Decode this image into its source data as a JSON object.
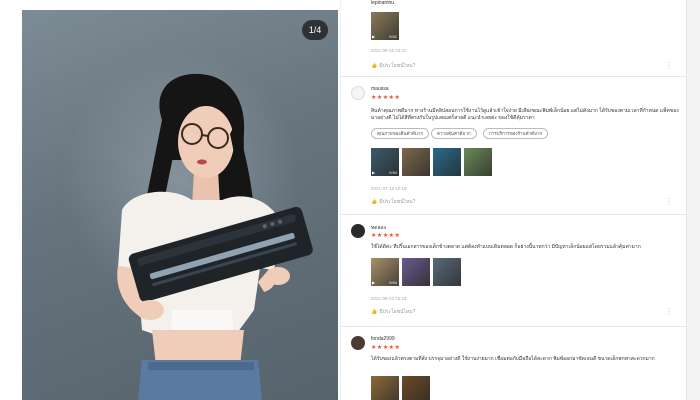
{
  "photo": {
    "counter": "1/4"
  },
  "reviews": [
    {
      "username": "lepinamnu",
      "thumbs": [
        {
          "color": "#8a7a5a",
          "duration": "0:51"
        }
      ],
      "date": "2021-08-16 23:37",
      "helpful": "มีประโยชน์ไหม?"
    },
    {
      "username": "maussa",
      "stars": "★★★★★",
      "text": "สินค้าคุณภาพดีมาก ทางร้านมีคลิปสอนการใช้งานไว้ดูแล้วเข้าใจง่าย มีเสียงขณะพิมพ์เล็กน้อย แต่ไม่ดังมาก ได้รับของตามเวลาที่กำหนด แพ็คของมาอย่างดี ไม่ได้สีที่ตรงกับในรูปเลยแต่ก็สวยดี แนะนำเลยค่ะ ของใช้ดีคุ้มราคา",
      "tags": [
        "คุณภาพของสินค้าดีมาก",
        "ความคุ้มค่าดีมาก",
        "การบริการของร้านค้าดีมาก"
      ],
      "thumbs": [
        {
          "color": "#3c5a6a",
          "duration": "0:54"
        },
        {
          "color": "#7b6a4c"
        },
        {
          "color": "#2a6a8a"
        },
        {
          "color": "#6a8a5a"
        }
      ],
      "date": "2021-07-12 10:18",
      "helpful": "มีประโยชน์ไหม?"
    },
    {
      "username": "ทดลอง",
      "stars": "★★★★★",
      "text": "ใช้ได้ดีค่ะ ที่ปริ้นเอกสารของเด็กข้างตลาด แต่ต้องทำแบบเดิมตลอด ก็อย่างนี้นาทกว่า มีปัญหาเล็กน้อยแต่โดยรวมแล้วคุ้มค่ามาก",
      "thumbs": [
        {
          "color": "#a8906a",
          "duration": "0:54"
        },
        {
          "color": "#6a5a8a"
        },
        {
          "color": "#5a6a7a"
        }
      ],
      "date": "2021-06-22 15:18",
      "helpful": "มีประโยชน์ไหม?"
    },
    {
      "username": "fonda2999",
      "stars": "★★★★★",
      "text": "ได้รับของแล้วตรงตามที่สั่ง บรรจุมาอย่างดี ใช้งานง่ายมาก เชื่อมต่อกับมือถือได้สะดวก พิมพ์ออกมาชัดเจนดี ขนาดเล็กพกพาสะดวกมาก",
      "thumbs": [
        {
          "color": "#8a6a3a"
        },
        {
          "color": "#6a4a2a"
        }
      ]
    }
  ],
  "colors": {
    "star": "#ee4d2d",
    "divider": "#e9e9e9"
  }
}
